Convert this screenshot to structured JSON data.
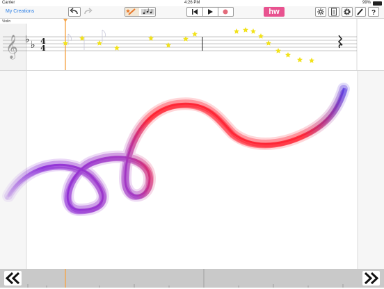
{
  "status_bar": {
    "carrier": "Carrier",
    "time": "4:26 PM",
    "battery": "99%"
  },
  "toolbar": {
    "back_label": "My Creations",
    "undo_icon": "undo-icon",
    "redo_icon": "redo-icon",
    "tools": [
      "magic-wand-icon",
      "sheet-music-icon"
    ],
    "transport": [
      "skip-back-icon",
      "play-icon",
      "record-icon"
    ],
    "logo": "hw",
    "right_tools": [
      "sparkle-icon",
      "document-icon",
      "gear-icon",
      "pen-icon",
      "help-icon"
    ],
    "colors": {
      "accent": "#2a7ee6",
      "logo_bg": "#e8528f",
      "record": "#e36a7a"
    }
  },
  "score": {
    "track_name": "Violin",
    "time_signature": {
      "top": "4",
      "bottom": "4"
    },
    "key": "flat",
    "star_color": "#f2e21a",
    "playhead_color": "#f5a54a"
  },
  "canvas": {
    "stroke_colors": [
      "#8a2ad8",
      "#ff1a2a",
      "#3d2fe0"
    ]
  },
  "navigation": {
    "prev_icon": "double-chevron-left-icon",
    "next_icon": "double-chevron-right-icon"
  }
}
